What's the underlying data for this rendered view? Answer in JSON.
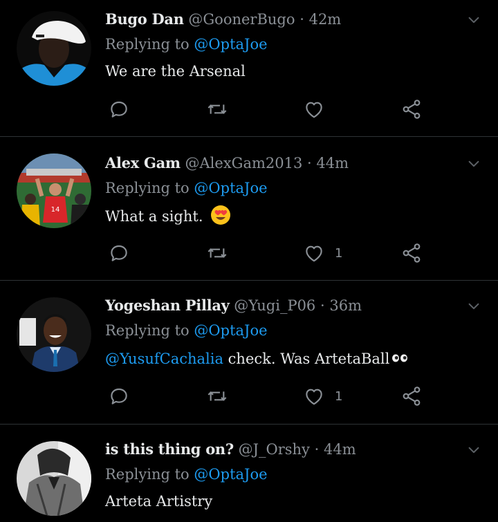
{
  "tweets": [
    {
      "name": "Bugo Dan",
      "handle": "@GoonerBugo",
      "dot": "·",
      "time": "42m",
      "reply_prefix": "Replying to",
      "reply_to": "@OptaJoe",
      "text": "We are the Arsenal",
      "mention": "",
      "emoji": "",
      "like_count": ""
    },
    {
      "name": "Alex Gam",
      "handle": "@AlexGam2013",
      "dot": "·",
      "time": "44m",
      "reply_prefix": "Replying to",
      "reply_to": "@OptaJoe",
      "text": "What a sight.",
      "mention": "",
      "emoji": "smiling-face-with-heart-eyes",
      "like_count": "1"
    },
    {
      "name": "Yogeshan Pillay",
      "handle": "@Yugi_P06",
      "dot": "·",
      "time": "36m",
      "reply_prefix": "Replying to",
      "reply_to": "@OptaJoe",
      "mention": "@YusufCachalia",
      "text": "check. Was ArtetaBall",
      "emoji": "eyes",
      "like_count": "1"
    },
    {
      "name": "is this thing on?",
      "handle": "@J_Orshy",
      "dot": "·",
      "time": "44m",
      "reply_prefix": "Replying to",
      "reply_to": "@OptaJoe",
      "text": "Arteta Artistry",
      "mention": "",
      "emoji": "",
      "like_count": ""
    }
  ],
  "icons": {
    "reply": "reply-icon",
    "retweet": "retweet-icon",
    "like": "heart-icon",
    "share": "share-icon",
    "more": "chevron-down-icon"
  },
  "colors": {
    "background": "#000000",
    "text": "#e7e9ea",
    "secondary": "#8b9096",
    "accent": "#1d9bf0",
    "divider": "#2f3336"
  }
}
